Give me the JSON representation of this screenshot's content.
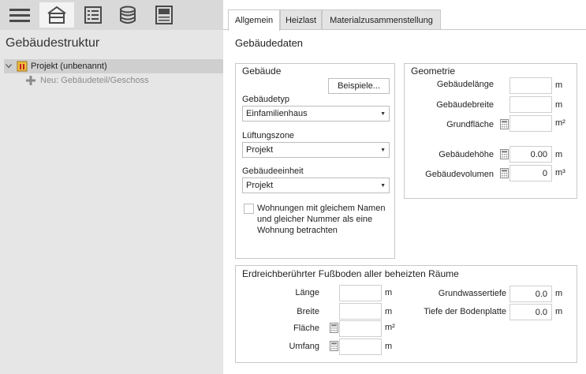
{
  "toolbar": {
    "icons": [
      "hamburger-menu-icon",
      "building-icon",
      "list-icon",
      "database-icon",
      "document-icon"
    ]
  },
  "structure": {
    "title": "Gebäudestruktur",
    "project_label": "Projekt (unbenannt)",
    "new_item_label": "Neu: Gebäudeteil/Geschoss"
  },
  "tabs": [
    {
      "label": "Allgemein",
      "active": true
    },
    {
      "label": "Heizlast",
      "active": false
    },
    {
      "label": "Materialzusammenstellung",
      "active": false
    }
  ],
  "main": {
    "section_title": "Gebäudedaten"
  },
  "gebaeude": {
    "title": "Gebäude",
    "examples_button": "Beispiele...",
    "type_label": "Gebäudetyp",
    "type_value": "Einfamilienhaus",
    "zone_label": "Lüftungszone",
    "zone_value": "Projekt",
    "unit_label": "Gebäudeeinheit",
    "unit_value": "Projekt",
    "checkbox_label_line1": "Wohnungen mit gleichem Namen",
    "checkbox_label_line2": "und gleicher Nummer als eine",
    "checkbox_label_line3": "Wohnung betrachten"
  },
  "geometrie": {
    "title": "Geometrie",
    "laenge_label": "Gebäudelänge",
    "laenge_value": "",
    "laenge_unit": "m",
    "breite_label": "Gebäudebreite",
    "breite_value": "",
    "breite_unit": "m",
    "flaeche_label": "Grundfläche",
    "flaeche_value": "",
    "flaeche_unit": "m²",
    "hoehe_label": "Gebäudehöhe",
    "hoehe_value": "0.00",
    "hoehe_unit": "m",
    "volumen_label": "Gebäudevolumen",
    "volumen_value": "0",
    "volumen_unit": "m³"
  },
  "erdreich": {
    "title": "Erdreichberührter Fußboden aller beheizten Räume",
    "laenge_label": "Länge",
    "laenge_value": "",
    "laenge_unit": "m",
    "breite_label": "Breite",
    "breite_value": "",
    "breite_unit": "m",
    "flaeche_label": "Fläche",
    "flaeche_value": "",
    "flaeche_unit": "m²",
    "umfang_label": "Umfang",
    "umfang_value": "",
    "umfang_unit": "m",
    "grundwasser_label": "Grundwassertiefe",
    "grundwasser_value": "0.0",
    "grundwasser_unit": "m",
    "bodenplatte_label": "Tiefe der Bodenplatte",
    "bodenplatte_value": "0.0",
    "bodenplatte_unit": "m"
  }
}
